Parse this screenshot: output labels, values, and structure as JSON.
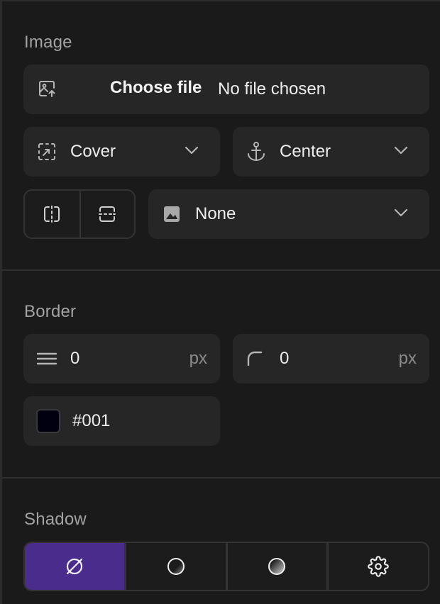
{
  "image": {
    "title": "Image",
    "file": {
      "button_label": "Choose file",
      "status": "No file chosen",
      "icon": "image-upload-icon"
    },
    "fit": {
      "value": "Cover",
      "icon": "fit-icon"
    },
    "anchor": {
      "value": "Center",
      "icon": "anchor-icon"
    },
    "flip_buttons": [
      {
        "icon": "flip-horizontal-icon"
      },
      {
        "icon": "flip-vertical-icon"
      }
    ],
    "filter": {
      "value": "None",
      "icon": "image-filter-icon"
    }
  },
  "border": {
    "title": "Border",
    "width": {
      "value": "0",
      "unit": "px",
      "icon": "border-width-icon"
    },
    "radius": {
      "value": "0",
      "unit": "px",
      "icon": "corner-radius-icon"
    },
    "color": {
      "value": "#001",
      "swatch": "#000011"
    }
  },
  "shadow": {
    "title": "Shadow",
    "options": [
      {
        "icon": "no-shadow-icon",
        "active": true
      },
      {
        "icon": "small-shadow-icon",
        "active": false
      },
      {
        "icon": "large-shadow-icon",
        "active": false
      },
      {
        "icon": "settings-gear-icon",
        "active": false
      }
    ]
  },
  "colors": {
    "accent": "#4a2c8c",
    "field_bg": "#262626",
    "panel_bg": "#1a1a1a"
  }
}
